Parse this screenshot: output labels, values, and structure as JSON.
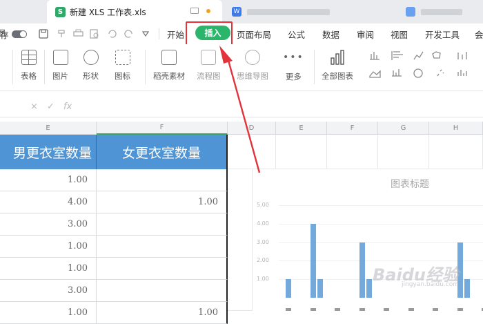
{
  "tabs": {
    "active_title": "新建 XLS 工作表.xls",
    "s_letter": "S",
    "w_letter": "W"
  },
  "toolbar": {
    "save_partial": "存"
  },
  "menu": {
    "items": [
      "开始",
      "插入",
      "页面布局",
      "公式",
      "数据",
      "审阅",
      "视图",
      "开发工具",
      "会"
    ],
    "active": "插入"
  },
  "ribbon": {
    "items": [
      "图",
      "表格",
      "图片",
      "形状",
      "图标",
      "稻壳素材",
      "流程图",
      "思维导图",
      "更多",
      "全部图表"
    ]
  },
  "formula_bar": {
    "cancel": "×",
    "confirm": "✓",
    "fx": "fx"
  },
  "columns": {
    "left_partial": "E",
    "f_col": "F",
    "chart_cols": [
      "D",
      "E",
      "F",
      "G",
      "H"
    ]
  },
  "headers": {
    "left": "男更衣室数量",
    "right": "女更衣室数量"
  },
  "left_values": [
    "1.00",
    "4.00",
    "3.00",
    "1.00",
    "1.00",
    "3.00",
    "1.00"
  ],
  "right_values": [
    "",
    "1.00",
    "",
    "",
    "",
    "",
    "1.00"
  ],
  "chart_data": {
    "type": "bar",
    "title": "图表标题",
    "y_ticks": [
      "5.00",
      "4.00",
      "3.00",
      "2.00",
      "1.00"
    ],
    "ylim": [
      0,
      5
    ],
    "series": [
      {
        "values": [
          1,
          4,
          0,
          3,
          0,
          0,
          0,
          3,
          0
        ]
      },
      {
        "values": [
          0,
          1,
          0,
          1,
          0,
          0,
          0,
          1,
          0
        ]
      }
    ]
  },
  "watermark": {
    "brand": "Baidu经验",
    "url": "jingyan.baidu.com"
  },
  "colors": {
    "accent": "#2bb56b",
    "header_fill": "#4f95d6",
    "highlight": "#e2323c"
  }
}
